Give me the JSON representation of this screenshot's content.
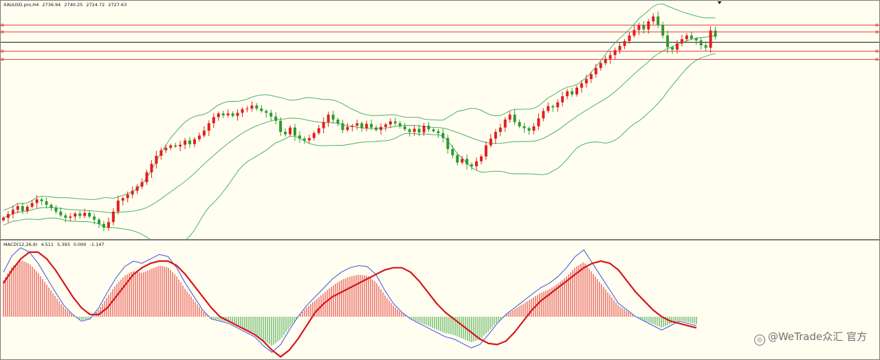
{
  "chart_title": {
    "symbol": "XAUUSD.pro,H4",
    "open": "2736.94",
    "high": "2740.25",
    "low": "2724.72",
    "close": "2727.63"
  },
  "macd_title": {
    "name": "MACD(12,26,9)",
    "macd": "4.511",
    "signal": "5.393",
    "extra1": "0.000",
    "extra2": "-1.147"
  },
  "watermark": "@WeTrade众汇 官方",
  "colors": {
    "background": "#fffef1",
    "bull": "#e0201c",
    "bear": "#2e9a2e",
    "bollinger": "#39a85a",
    "level_red": "#e8413b",
    "level_black": "#1a1a1a",
    "macd_line": "#3c4fe0",
    "signal_line": "#d8121a",
    "hist_pos": "#e0201c",
    "hist_neg": "#2e9a2e"
  },
  "icons": [
    "current-bar-marker-icon",
    "watermark-logo-icon"
  ],
  "chart_data": [
    {
      "type": "candlestick",
      "title": "XAUUSD.pro,H4",
      "ylim": [
        2450,
        2825
      ],
      "overlays": [
        "Bollinger Bands"
      ],
      "horizontal_levels": [
        {
          "value": 2792,
          "color": "red"
        },
        {
          "value": 2781,
          "color": "red"
        },
        {
          "value": 2764,
          "color": "black"
        },
        {
          "value": 2750,
          "color": "red"
        },
        {
          "value": 2737,
          "color": "red"
        }
      ],
      "closes": [
        2478,
        2484,
        2491,
        2497,
        2489,
        2496,
        2502,
        2508,
        2505,
        2499,
        2494,
        2488,
        2482,
        2478,
        2480,
        2485,
        2481,
        2486,
        2480,
        2475,
        2468,
        2462,
        2471,
        2488,
        2506,
        2510,
        2516,
        2522,
        2529,
        2536,
        2552,
        2566,
        2579,
        2588,
        2592,
        2596,
        2594,
        2597,
        2604,
        2598,
        2606,
        2612,
        2620,
        2632,
        2642,
        2648,
        2645,
        2648,
        2644,
        2649,
        2655,
        2656,
        2661,
        2656,
        2652,
        2649,
        2643,
        2636,
        2618,
        2614,
        2625,
        2612,
        2607,
        2604,
        2608,
        2616,
        2624,
        2634,
        2646,
        2638,
        2632,
        2621,
        2626,
        2628,
        2632,
        2624,
        2631,
        2625,
        2621,
        2626,
        2630,
        2635,
        2632,
        2627,
        2622,
        2618,
        2623,
        2617,
        2628,
        2622,
        2619,
        2616,
        2608,
        2590,
        2580,
        2568,
        2574,
        2565,
        2562,
        2570,
        2578,
        2596,
        2607,
        2618,
        2625,
        2638,
        2646,
        2634,
        2627,
        2624,
        2620,
        2627,
        2640,
        2652,
        2660,
        2658,
        2666,
        2676,
        2684,
        2679,
        2690,
        2697,
        2704,
        2712,
        2722,
        2730,
        2737,
        2743,
        2751,
        2758,
        2766,
        2775,
        2784,
        2792,
        2785,
        2798,
        2806,
        2792,
        2775,
        2756,
        2752,
        2762,
        2769,
        2775,
        2770,
        2767,
        2759,
        2755,
        2783,
        2773
      ]
    },
    {
      "type": "line",
      "title": "MACD(12,26,9)",
      "series": [
        {
          "values": [
            40,
            55,
            62,
            58,
            48,
            35,
            22,
            10,
            2,
            -4,
            -2,
            8,
            22,
            35,
            45,
            50,
            48,
            52,
            56,
            54,
            44,
            30,
            18,
            6,
            -2,
            -4,
            -6,
            -10,
            -14,
            -18,
            -26,
            -32,
            -25,
            -12,
            0,
            10,
            18,
            26,
            34,
            40,
            44,
            46,
            45,
            38,
            24,
            12,
            4,
            -2,
            -6,
            -10,
            -14,
            -18,
            -20,
            -24,
            -28,
            -25,
            -16,
            -6,
            2,
            8,
            14,
            20,
            26,
            30,
            36,
            44,
            54,
            60,
            48,
            36,
            24,
            12,
            6,
            0,
            -4,
            -8,
            -12,
            -8,
            -4,
            -6,
            -8
          ]
        },
        {
          "values": [
            30,
            42,
            52,
            58,
            58,
            52,
            42,
            30,
            18,
            8,
            2,
            2,
            8,
            18,
            28,
            38,
            44,
            48,
            50,
            50,
            46,
            38,
            28,
            18,
            8,
            0,
            -4,
            -8,
            -12,
            -16,
            -22,
            -30,
            -36,
            -30,
            -20,
            -8,
            4,
            12,
            18,
            22,
            26,
            30,
            34,
            38,
            42,
            44,
            44,
            40,
            32,
            22,
            12,
            4,
            -2,
            -8,
            -14,
            -20,
            -24,
            -25,
            -22,
            -14,
            -4,
            6,
            14,
            20,
            26,
            32,
            38,
            44,
            48,
            50,
            48,
            42,
            32,
            22,
            14,
            6,
            0,
            -4,
            -6,
            -8,
            -10
          ]
        }
      ]
    }
  ]
}
